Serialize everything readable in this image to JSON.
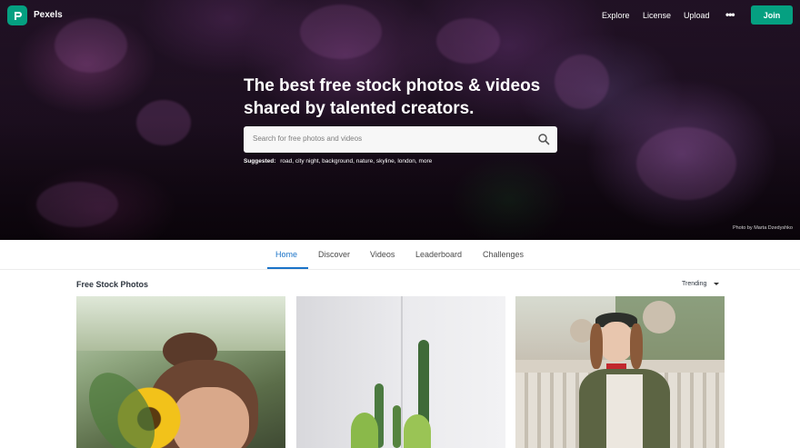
{
  "brand": {
    "name": "Pexels",
    "accent": "#05a081"
  },
  "nav": {
    "links": [
      "Explore",
      "License",
      "Upload"
    ],
    "more_icon": "more-dots-icon",
    "join_label": "Join"
  },
  "hero": {
    "headline_line1": "The best free stock photos & videos",
    "headline_line2": "shared by talented creators.",
    "search_placeholder": "Search for free photos and videos",
    "search_icon": "search-icon",
    "suggested_label": "Suggested:",
    "suggestions": [
      "road",
      "city night",
      "background",
      "nature",
      "skyline",
      "london",
      "more"
    ],
    "photo_credit": "Photo by Marta Dzedyshko"
  },
  "tabs": {
    "items": [
      "Home",
      "Discover",
      "Videos",
      "Leaderboard",
      "Challenges"
    ],
    "active": "Home",
    "active_color": "#1a73c8"
  },
  "section": {
    "title": "Free Stock Photos",
    "sort_value": "Trending"
  }
}
